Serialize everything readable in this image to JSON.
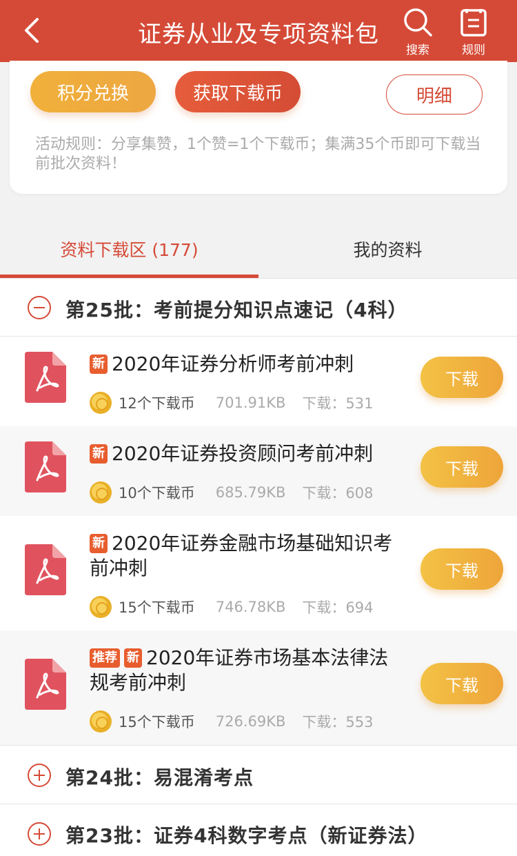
{
  "header": {
    "title": "证券从业及专项资料包",
    "search_label": "搜索",
    "rules_label": "规则"
  },
  "card": {
    "points_button": "积分兑换",
    "coins_button": "获取下载币",
    "detail_button": "明细",
    "rules_text": "活动规则：分享集赞，1个赞=1个下载币；集满35个币即可下载当前批次资料！"
  },
  "tabs": {
    "download_area": "资料下载区 (177)",
    "my_materials": "我的资料"
  },
  "batches": [
    {
      "title": "第25批：考前提分知识点速记（4科）",
      "expanded": true
    },
    {
      "title": "第24批：易混淆考点",
      "expanded": false
    },
    {
      "title": "第23批：证券4科数字考点（新证券法）",
      "expanded": false
    }
  ],
  "items": [
    {
      "tag_recommend": "",
      "tag_new": "新",
      "title": "2020年证券分析师考前冲刺",
      "coins": "12个下载币",
      "size": "701.91KB",
      "downloads": "下载：531",
      "button": "下载"
    },
    {
      "tag_recommend": "",
      "tag_new": "新",
      "title": "2020年证券投资顾问考前冲刺",
      "coins": "10个下载币",
      "size": "685.79KB",
      "downloads": "下载：608",
      "button": "下载"
    },
    {
      "tag_recommend": "",
      "tag_new": "新",
      "title": "2020年证券金融市场基础知识考前冲刺",
      "coins": "15个下载币",
      "size": "746.78KB",
      "downloads": "下载：694",
      "button": "下载"
    },
    {
      "tag_recommend": "推荐",
      "tag_new": "新",
      "title": "2020年证券市场基本法律法规考前冲刺",
      "coins": "15个下载币",
      "size": "726.69KB",
      "downloads": "下载：553",
      "button": "下载"
    }
  ],
  "colors": {
    "brand_red": "#d54a37",
    "orange_button": "#eea742",
    "tag_orange": "#e85d2e"
  },
  "icons": [
    "back-arrow-icon",
    "search-icon",
    "clipboard-icon",
    "minus-circle-icon",
    "plus-circle-icon",
    "pdf-file-icon",
    "coin-icon"
  ]
}
